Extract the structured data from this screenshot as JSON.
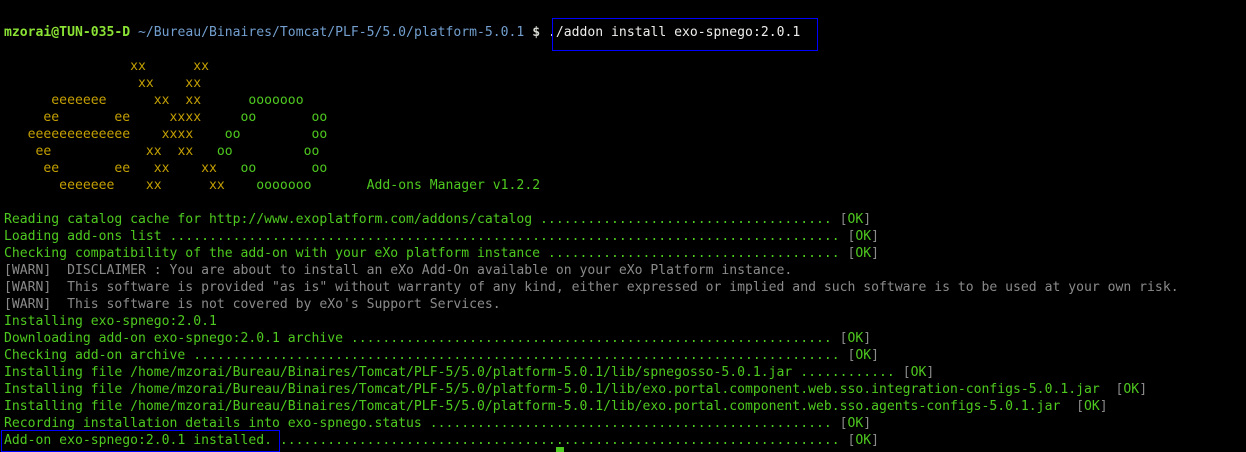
{
  "prompt": {
    "user": "mzorai@TUN-035-D",
    "path": "~/Bureau/Binaires/Tomcat/PLF-5/5.0/platform-5.0.1",
    "symbol": "$",
    "command": "./addon install exo-spnego:2.0.1"
  },
  "banner": {
    "row1": "                xx      xx",
    "row2": "                 xx    xx",
    "row3_e": "      eeeeeee      ",
    "row3_x": "xx  xx",
    "row3_o": "      ooooooo",
    "row4_e": "     ee       ee     ",
    "row4_x": "xxxx",
    "row4_o": "     oo       oo",
    "row5_e": "   eeeeeeeeeeeee    ",
    "row5_x": "xxxx",
    "row5_o": "    oo         oo",
    "row6_e": "    ee            ",
    "row6_x": "xx  xx",
    "row6_o": "   oo         oo",
    "row7_e": "     ee       ee   ",
    "row7_x": "xx    xx",
    "row7_o": "   oo       oo",
    "row8_e": "       eeeeeee    ",
    "row8_x": "xx      xx",
    "row8_o": "    ooooooo",
    "manager_label": "Add-ons Manager v1.2.2"
  },
  "log_lines": [
    {
      "text": "Reading catalog cache for http://www.exoplatform.com/addons/catalog ..................................... ",
      "status": "OK",
      "kind": "info"
    },
    {
      "text": "Loading add-ons list ..................................................................................... ",
      "status": "OK",
      "kind": "info"
    },
    {
      "text": "Checking compatibility of the add-on with your eXo platform instance ..................................... ",
      "status": "OK",
      "kind": "info"
    },
    {
      "text": "[WARN]  DISCLAIMER : You are about to install an eXo Add-On available on your eXo Platform instance.",
      "status": "",
      "kind": "warn"
    },
    {
      "text": "[WARN]  This software is provided \"as is\" without warranty of any kind, either expressed or implied and such software is to be used at your own risk.",
      "status": "",
      "kind": "warn"
    },
    {
      "text": "[WARN]  This software is not covered by eXo's Support Services.",
      "status": "",
      "kind": "warn"
    },
    {
      "text": "Installing exo-spnego:2.0.1",
      "status": "",
      "kind": "info"
    },
    {
      "text": "Downloading add-on exo-spnego:2.0.1 archive ............................................................. ",
      "status": "OK",
      "kind": "info"
    },
    {
      "text": "Checking add-on archive .................................................................................. ",
      "status": "OK",
      "kind": "info"
    },
    {
      "text": "Installing file /home/mzorai/Bureau/Binaires/Tomcat/PLF-5/5.0/platform-5.0.1/lib/spnegosso-5.0.1.jar ............ ",
      "status": "OK",
      "kind": "info"
    },
    {
      "text": "Installing file /home/mzorai/Bureau/Binaires/Tomcat/PLF-5/5.0/platform-5.0.1/lib/exo.portal.component.web.sso.integration-configs-5.0.1.jar  ",
      "status": "OK",
      "kind": "info"
    },
    {
      "text": "Installing file /home/mzorai/Bureau/Binaires/Tomcat/PLF-5/5.0/platform-5.0.1/lib/exo.portal.component.web.sso.agents-configs-5.0.1.jar  ",
      "status": "OK",
      "kind": "info"
    },
    {
      "text": "Recording installation details into exo-spnego.status ................................................... ",
      "status": "OK",
      "kind": "info"
    },
    {
      "text": "Add-on exo-spnego:2.0.1 installed. ....................................................................... ",
      "status": "OK",
      "kind": "info"
    }
  ],
  "colors": {
    "background": "#000000",
    "prompt_user": "#8ae234",
    "prompt_path": "#729fcf",
    "log_green": "#4ec91f",
    "banner_orange": "#c4a000",
    "warn_gray": "#8a8a8a",
    "highlight_border": "#0000ff"
  }
}
